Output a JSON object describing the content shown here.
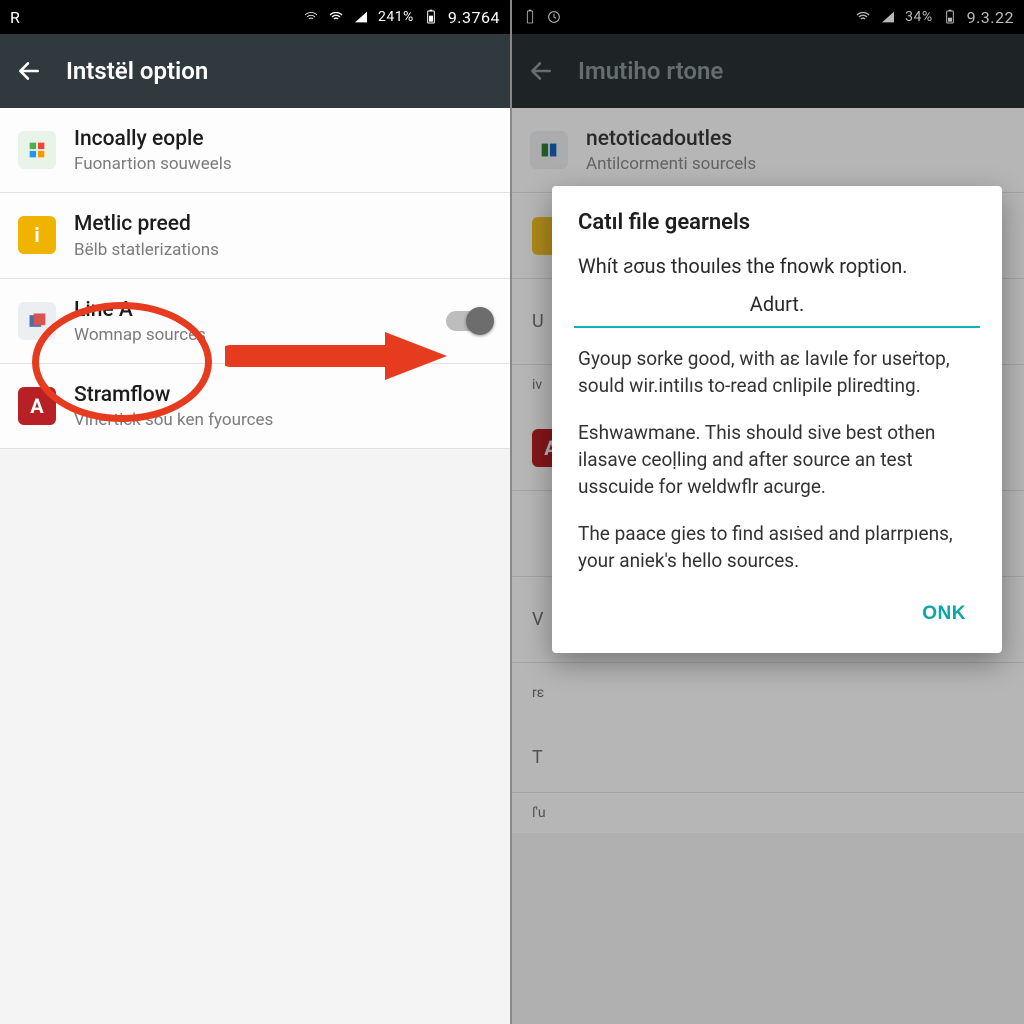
{
  "statusbar": {
    "left_carrier": "R",
    "left_battery_pct": "241%",
    "left_time": "9.3764",
    "right_battery_pct": "34%",
    "right_time": "9.3.22"
  },
  "left": {
    "title": "Intstël option",
    "rows": [
      {
        "title": "Incoally eople",
        "subtitle": "Fuonartion souweels"
      },
      {
        "title": "Metlic preed",
        "subtitle": "Bëlb statlerizations"
      },
      {
        "title": "Line A",
        "subtitle": "Womnap sources"
      },
      {
        "title": "Stramflow",
        "subtitle": "Vlhertick sou ken fyources"
      }
    ]
  },
  "right": {
    "title": "Imutiho rtone",
    "rows": [
      {
        "title": "netoticadoutles",
        "subtitle": "Antilcormenti sourcels"
      }
    ],
    "ghosts": {
      "g1_prefix": "U",
      "g1_sub": "iv",
      "g5_prefix": "rε",
      "g6_prefix": "T",
      "g6_sub": "ſ'u"
    },
    "dialog": {
      "heading": "Catıl file gearnels",
      "lead": "Whít ƨσus thouıles the fnowk roption.",
      "center_line": "Adurt.",
      "p1": "Gyoup sorke good, with aε lavıle for useṙtop, sould wir.intilıs to-read cnlipile pliredting.",
      "p2": "Eshwawmane. This should sive best othen ilasave ceoḷling and after source an test usscuide for weldwflr acurge.",
      "p3": "The paace gies to find asıṡed and plarrpıens, your aniek's hello sources.",
      "ok_label": "ONK"
    }
  },
  "icons": {
    "back": "back-arrow-icon",
    "wifi": "wifi-icon",
    "signal": "signal-icon",
    "battery": "battery-icon",
    "batt_charge": "battery-charging-icon",
    "clock": "clock-icon"
  }
}
